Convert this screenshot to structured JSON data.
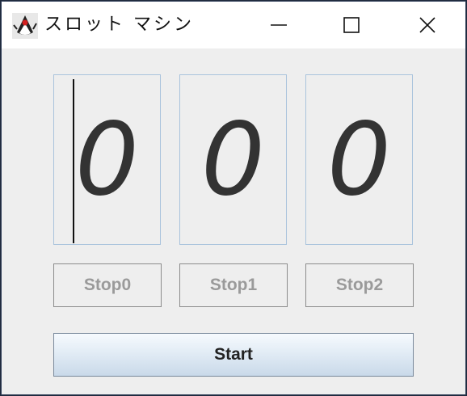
{
  "window": {
    "title": "スロット マシン",
    "icon": "java-duke-icon",
    "controls": [
      "minimize-icon",
      "maximize-icon",
      "close-icon"
    ]
  },
  "reels": [
    {
      "digit": "0"
    },
    {
      "digit": "0"
    },
    {
      "digit": "0"
    }
  ],
  "buttons": {
    "stop0": "Stop0",
    "stop1": "Stop1",
    "stop2": "Stop2",
    "start": "Start"
  },
  "colors": {
    "window_bg": "#eeeeee",
    "reel_border": "#a9c3dc",
    "digit": "#333333",
    "disabled_text": "#9a9a9a"
  }
}
